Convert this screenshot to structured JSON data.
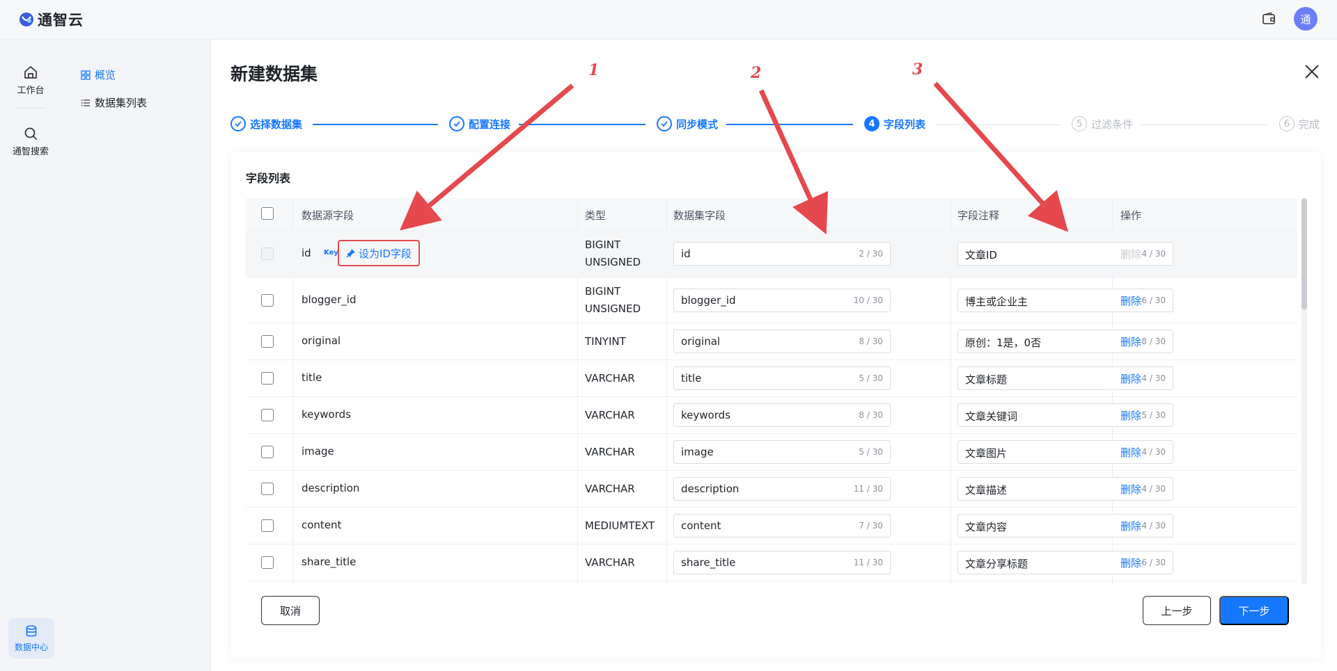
{
  "app": {
    "name": "通智云",
    "avatar_text": "通"
  },
  "rail": {
    "items": [
      {
        "label": "工作台",
        "icon": "home-icon"
      },
      {
        "label": "通智搜索",
        "icon": "search-icon"
      }
    ],
    "bottom": {
      "label": "数据中心",
      "icon": "database-icon"
    }
  },
  "subnav": {
    "items": [
      {
        "label": "概览",
        "icon": "grid-icon",
        "active": true
      },
      {
        "label": "数据集列表",
        "icon": "list-icon",
        "active": false
      }
    ]
  },
  "page": {
    "title": "新建数据集"
  },
  "steps": [
    {
      "num": "1",
      "label": "选择数据集",
      "state": "done"
    },
    {
      "num": "2",
      "label": "配置连接",
      "state": "done"
    },
    {
      "num": "3",
      "label": "同步模式",
      "state": "done"
    },
    {
      "num": "4",
      "label": "字段列表",
      "state": "current"
    },
    {
      "num": "5",
      "label": "过滤条件",
      "state": "todo"
    },
    {
      "num": "6",
      "label": "完成",
      "state": "todo"
    }
  ],
  "card": {
    "title": "字段列表"
  },
  "table": {
    "headers": [
      "数据源字段",
      "类型",
      "数据集字段",
      "字段注释",
      "操作"
    ],
    "key_badge": "Key",
    "set_id_label": "设为ID字段",
    "rows": [
      {
        "source": "id",
        "type": "BIGINT UNSIGNED",
        "field": "id",
        "field_count": "2 / 30",
        "comment": "文章ID",
        "comment_count": "4 / 30",
        "action": "删除"
      },
      {
        "source": "blogger_id",
        "type": "BIGINT UNSIGNED",
        "field": "blogger_id",
        "field_count": "10 / 30",
        "comment": "博主或企业主",
        "comment_count": "6 / 30",
        "action": "删除"
      },
      {
        "source": "original",
        "type": "TINYINT",
        "field": "original",
        "field_count": "8 / 30",
        "comment": "原创：1是，0否",
        "comment_count": "8 / 30",
        "action": "删除"
      },
      {
        "source": "title",
        "type": "VARCHAR",
        "field": "title",
        "field_count": "5 / 30",
        "comment": "文章标题",
        "comment_count": "4 / 30",
        "action": "删除"
      },
      {
        "source": "keywords",
        "type": "VARCHAR",
        "field": "keywords",
        "field_count": "8 / 30",
        "comment": "文章关键词",
        "comment_count": "5 / 30",
        "action": "删除"
      },
      {
        "source": "image",
        "type": "VARCHAR",
        "field": "image",
        "field_count": "5 / 30",
        "comment": "文章图片",
        "comment_count": "4 / 30",
        "action": "删除"
      },
      {
        "source": "description",
        "type": "VARCHAR",
        "field": "description",
        "field_count": "11 / 30",
        "comment": "文章描述",
        "comment_count": "4 / 30",
        "action": "删除"
      },
      {
        "source": "content",
        "type": "MEDIUMTEXT",
        "field": "content",
        "field_count": "7 / 30",
        "comment": "文章内容",
        "comment_count": "4 / 30",
        "action": "删除"
      },
      {
        "source": "share_title",
        "type": "VARCHAR",
        "field": "share_title",
        "field_count": "11 / 30",
        "comment": "文章分享标题",
        "comment_count": "6 / 30",
        "action": "删除"
      }
    ]
  },
  "footer": {
    "cancel": "取消",
    "prev": "上一步",
    "next": "下一步"
  },
  "annotations": [
    "1",
    "2",
    "3"
  ],
  "colors": {
    "accent": "#1677ff",
    "annotation": "#e5484d"
  }
}
